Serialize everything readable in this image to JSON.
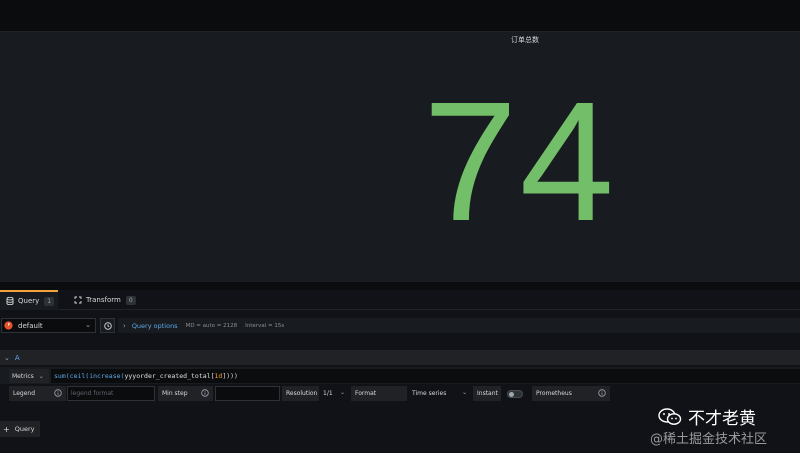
{
  "panel": {
    "title": "订单总数",
    "value": "74",
    "value_color": "#73bf69"
  },
  "tabs": [
    {
      "label": "Query",
      "count": "1",
      "icon": "database-icon",
      "active": true
    },
    {
      "label": "Transform",
      "count": "0",
      "icon": "transform-icon",
      "active": false
    }
  ],
  "datasource": {
    "name": "default",
    "icon": "prometheus-icon"
  },
  "query_options": {
    "label": "Query options",
    "md": "MD = auto = 2128",
    "interval": "Interval = 15s"
  },
  "query": {
    "ref_id": "A",
    "metrics_label": "Metrics",
    "expr_fn1": "sum(",
    "expr_fn2": "ceil(",
    "expr_fn3": "increase(",
    "expr_metric": "yyyorder_created_total",
    "expr_range_open": "[",
    "expr_range": "1d",
    "expr_range_close": "]",
    "expr_close": ")))"
  },
  "options": {
    "legend_label": "Legend",
    "legend_placeholder": "legend format",
    "minstep_label": "Min step",
    "resolution_label": "Resolution",
    "resolution_value": "1/1",
    "format_label": "Format",
    "format_value": "Time series",
    "instant_label": "Instant",
    "prometheus_label": "Prometheus"
  },
  "add_query_label": "Query",
  "watermark": {
    "line1": "不才老黄",
    "line2": "@稀土掘金技术社区"
  },
  "colors": {
    "accent": "#f2a23c",
    "link": "#5fa8ea",
    "background": "#111217"
  }
}
